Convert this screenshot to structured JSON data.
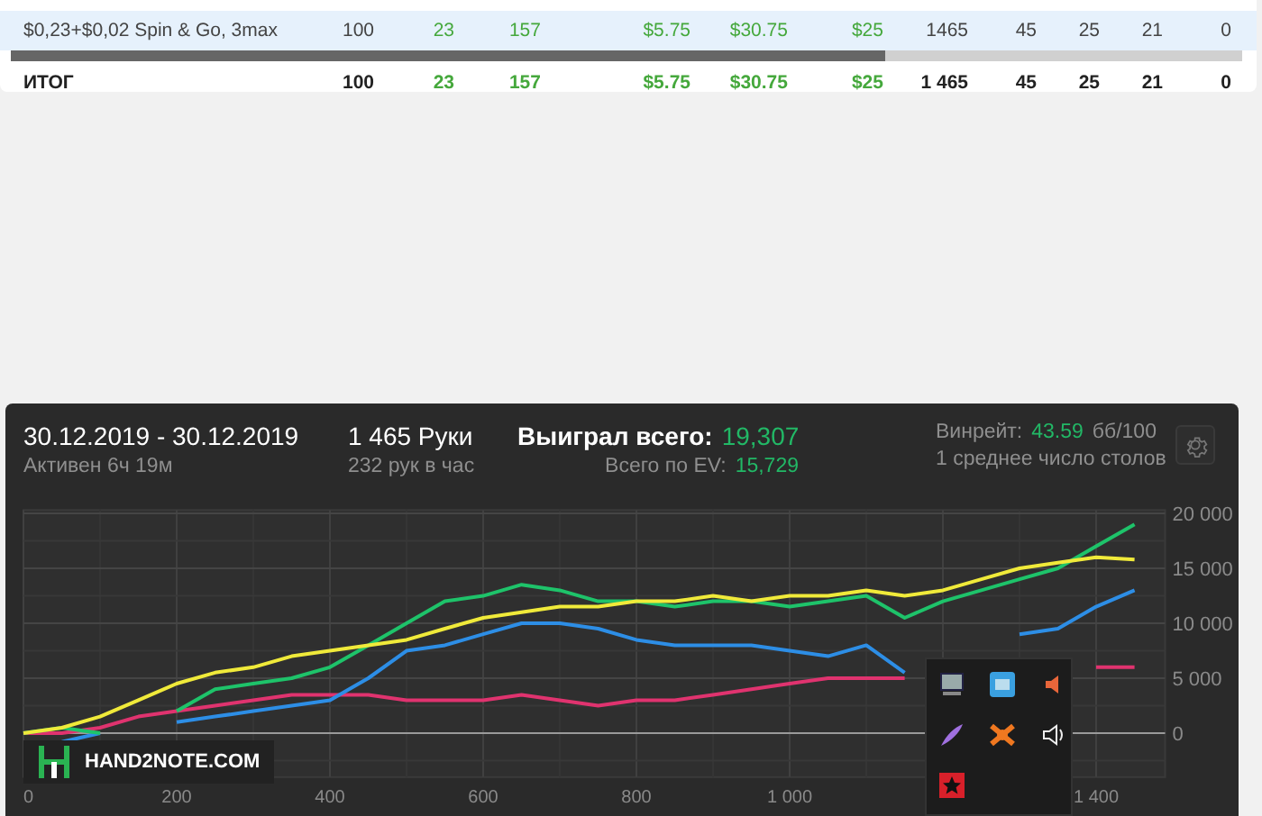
{
  "table": {
    "rows": [
      {
        "selected": true,
        "cells": [
          {
            "text": "$0,23+$0,02 Spin & Go, 3max",
            "color": "#444444"
          },
          {
            "text": "100",
            "color": "#444444"
          },
          {
            "text": "23",
            "color": "#45a83c"
          },
          {
            "text": "157",
            "color": "#45a83c"
          },
          {
            "text": "$5.75",
            "color": "#45a83c"
          },
          {
            "text": "$30.75",
            "color": "#45a83c"
          },
          {
            "text": "$25",
            "color": "#45a83c"
          },
          {
            "text": "1465",
            "color": "#444444"
          },
          {
            "text": "45",
            "color": "#444444"
          },
          {
            "text": "25",
            "color": "#444444"
          },
          {
            "text": "21",
            "color": "#444444"
          },
          {
            "text": "0",
            "color": "#444444"
          }
        ]
      }
    ],
    "total": {
      "cells": [
        {
          "text": "ИТОГ",
          "color": "#222222"
        },
        {
          "text": "100",
          "color": "#222222"
        },
        {
          "text": "23",
          "color": "#45a83c"
        },
        {
          "text": "157",
          "color": "#45a83c"
        },
        {
          "text": "$5.75",
          "color": "#45a83c"
        },
        {
          "text": "$30.75",
          "color": "#45a83c"
        },
        {
          "text": "$25",
          "color": "#45a83c"
        },
        {
          "text": "1 465",
          "color": "#222222"
        },
        {
          "text": "45",
          "color": "#222222"
        },
        {
          "text": "25",
          "color": "#222222"
        },
        {
          "text": "21",
          "color": "#222222"
        },
        {
          "text": "0",
          "color": "#222222"
        }
      ]
    }
  },
  "graph": {
    "period": "30.12.2019 - 30.12.2019",
    "active": "Активен 6ч 19м",
    "hands": "1 465 Руки",
    "hands_rate": "232 рук в час",
    "won_label": "Выиграл всего:",
    "won_value": "19,307",
    "ev_label": "Всего по EV:",
    "ev_value": "15,729",
    "winrate_label": "Винрейт:",
    "winrate_value": "43.59",
    "winrate_unit": "бб/100",
    "tables": "1 среднее число столов",
    "logo": "HAND2NOTE.COM",
    "chart_data": {
      "type": "line",
      "grid": true,
      "x": [
        0,
        50,
        100,
        150,
        200,
        250,
        300,
        350,
        400,
        450,
        500,
        550,
        600,
        650,
        700,
        750,
        800,
        850,
        900,
        950,
        1000,
        1050,
        1100,
        1150,
        1200,
        1250,
        1300,
        1350,
        1400,
        1450
      ],
      "xlim": [
        0,
        1490
      ],
      "ylim": [
        -4000,
        20300
      ],
      "xticks": [
        {
          "value": 0,
          "label": "0"
        },
        {
          "value": 200,
          "label": "200"
        },
        {
          "value": 400,
          "label": "400"
        },
        {
          "value": 600,
          "label": "600"
        },
        {
          "value": 800,
          "label": "800"
        },
        {
          "value": 1000,
          "label": "1 000"
        },
        {
          "value": 1400,
          "label": "1 400"
        }
      ],
      "yticks": [
        {
          "value": 0,
          "label": "0"
        },
        {
          "value": 5000,
          "label": "5 000"
        },
        {
          "value": 10000,
          "label": "10 000"
        },
        {
          "value": 15000,
          "label": "15 000"
        },
        {
          "value": 20000,
          "label": "20 000"
        }
      ],
      "series": [
        {
          "color": "#e0336f",
          "values": [
            0,
            0,
            500,
            1500,
            2000,
            2500,
            3000,
            3500,
            3500,
            3500,
            3000,
            3000,
            3000,
            3500,
            3000,
            2500,
            3000,
            3000,
            3500,
            4000,
            4500,
            5000,
            5000,
            5000,
            null,
            null,
            null,
            null,
            6000,
            6000
          ]
        },
        {
          "color": "#2d8ee6",
          "values": [
            null,
            -800,
            0,
            null,
            1000,
            1500,
            2000,
            2500,
            3000,
            5000,
            7500,
            8000,
            9000,
            10000,
            10000,
            9500,
            8500,
            8000,
            8000,
            8000,
            7500,
            7000,
            8000,
            5500,
            null,
            null,
            9000,
            9500,
            11500,
            13000
          ]
        },
        {
          "color": "#1ec36a",
          "values": [
            0,
            500,
            0,
            null,
            2000,
            4000,
            4500,
            5000,
            6000,
            8000,
            10000,
            12000,
            12500,
            13500,
            13000,
            12000,
            12000,
            11500,
            12000,
            12000,
            11500,
            12000,
            12500,
            10500,
            12000,
            13000,
            14000,
            15000,
            17000,
            19000
          ]
        },
        {
          "color": "#f0ea3a",
          "values": [
            0,
            500,
            1500,
            3000,
            4500,
            5500,
            6000,
            7000,
            7500,
            8000,
            8500,
            9500,
            10500,
            11000,
            11500,
            11500,
            12000,
            12000,
            12500,
            12000,
            12500,
            12500,
            13000,
            12500,
            13000,
            14000,
            15000,
            15500,
            16000,
            15800
          ]
        }
      ]
    }
  },
  "tray": {
    "icons": [
      {
        "kind": "monitor"
      },
      {
        "kind": "app"
      },
      {
        "kind": "speaker-orange"
      },
      {
        "kind": "feather"
      },
      {
        "kind": "shield"
      },
      {
        "kind": "speaker"
      },
      {
        "kind": "star"
      }
    ]
  }
}
